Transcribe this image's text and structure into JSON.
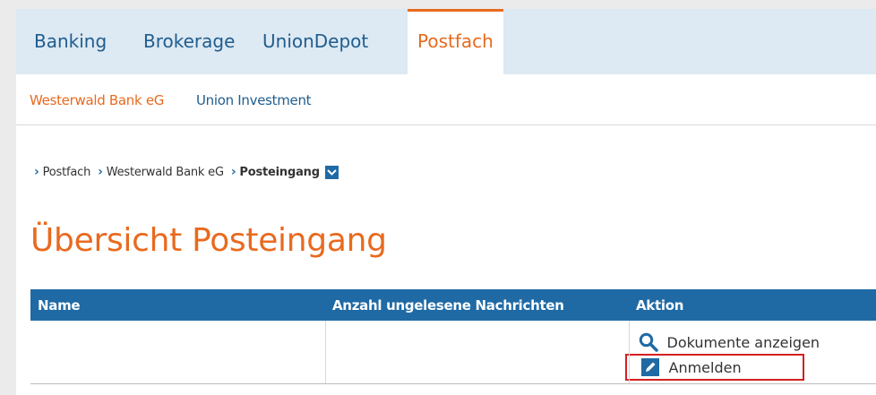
{
  "top_nav": {
    "tabs": [
      {
        "label": "Banking"
      },
      {
        "label": "Brokerage"
      },
      {
        "label": "UnionDepot"
      },
      {
        "label": "Postfach",
        "active": true
      }
    ]
  },
  "sub_nav": {
    "links": [
      {
        "label": "Westerwald Bank eG",
        "active": true
      },
      {
        "label": "Union Investment"
      }
    ]
  },
  "breadcrumb": {
    "items": [
      "Postfach",
      "Westerwald Bank eG"
    ],
    "current": "Posteingang"
  },
  "page_title": "Übersicht Posteingang",
  "table": {
    "headers": [
      "Name",
      "Anzahl ungelesene Nachrichten",
      "Aktion"
    ],
    "rows": [
      {
        "name": "",
        "unread": "",
        "actions": [
          {
            "label": "Dokumente anzeigen",
            "icon": "search-icon"
          },
          {
            "label": "Anmelden",
            "icon": "pencil-icon"
          }
        ]
      }
    ]
  },
  "colors": {
    "accent_orange": "#e86a1f",
    "primary_blue": "#1f6aa5",
    "nav_bg": "#dde9f3",
    "highlight_red": "#d42020"
  }
}
